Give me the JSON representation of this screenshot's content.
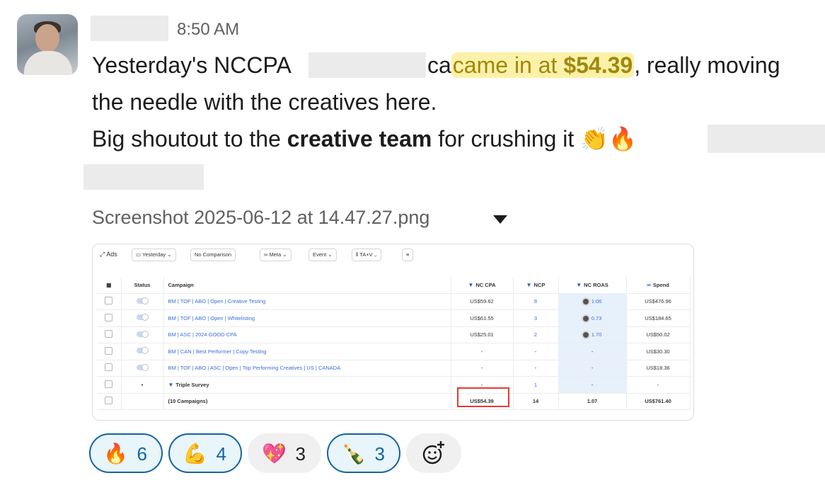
{
  "message": {
    "timestamp": "8:50 AM",
    "line1_prefix": "Yesterday's NCCPA",
    "line1_hl_1": "came in at ",
    "line1_hl_amount": "$54.39",
    "line1_suffix": ", really moving",
    "line2": "the needle with the creatives here.",
    "line3_prefix": "Big shoutout to the ",
    "line3_bold": "creative team",
    "line3_suffix": " for crushing it ",
    "line3_emoji": "👏🔥"
  },
  "attachment": {
    "file_name": "Screenshot 2025-06-12 at 14.47.27.png"
  },
  "dashboard": {
    "toolbar": {
      "ads_label": "Ads",
      "date": "Yesterday",
      "comparison": "No Comparison",
      "platform": "Meta",
      "event": "Event",
      "attribution": "TA+V"
    },
    "columns": [
      "Status",
      "Campaign",
      "NC CPA",
      "NCP",
      "NC ROAS",
      "Spend"
    ],
    "rows": [
      {
        "campaign": "BM | TOF | ABO | Open | Creative Testing",
        "nc_cpa": "US$59.62",
        "ncp": "8",
        "nc_roas": "1.06",
        "spend": "US$476.96"
      },
      {
        "campaign": "BM | TOF | ABO | Open | Whitelisting",
        "nc_cpa": "US$61.55",
        "ncp": "3",
        "nc_roas": "0.73",
        "spend": "US$184.65"
      },
      {
        "campaign": "BM | ASC | 2024 GOOD CPA",
        "nc_cpa": "US$25.01",
        "ncp": "2",
        "nc_roas": "1.70",
        "spend": "US$50.02"
      },
      {
        "campaign": "BM | CAN | Best Performer | Copy Testing",
        "nc_cpa": "-",
        "ncp": "-",
        "nc_roas": "-",
        "spend": "US$30.30"
      },
      {
        "campaign": "BM | TOF | ABO | ASC | Open | Top Performing Creatives | US | CANADA",
        "nc_cpa": "-",
        "ncp": "-",
        "nc_roas": "-",
        "spend": "US$18.36"
      },
      {
        "campaign": "Triple Survey",
        "nc_cpa": "-",
        "ncp": "1",
        "nc_roas": "-",
        "spend": "-"
      }
    ],
    "total": {
      "campaign": "(10 Campaigns)",
      "nc_cpa": "US$54.39",
      "ncp": "14",
      "nc_roas": "1.07",
      "spend": "US$761.40"
    }
  },
  "reactions": [
    {
      "emoji": "🔥",
      "count": "6",
      "selected": true
    },
    {
      "emoji": "💪",
      "count": "4",
      "selected": true
    },
    {
      "emoji": "💖",
      "count": "3",
      "selected": false
    },
    {
      "emoji": "🍾",
      "count": "3",
      "selected": true
    }
  ],
  "colors": {
    "highlight_bg": "#fcf1a9",
    "highlight_text": "#a0880e",
    "reaction_selected_border": "#1264a3",
    "link_blue": "#3b6ed6",
    "red_box": "#e53935"
  }
}
